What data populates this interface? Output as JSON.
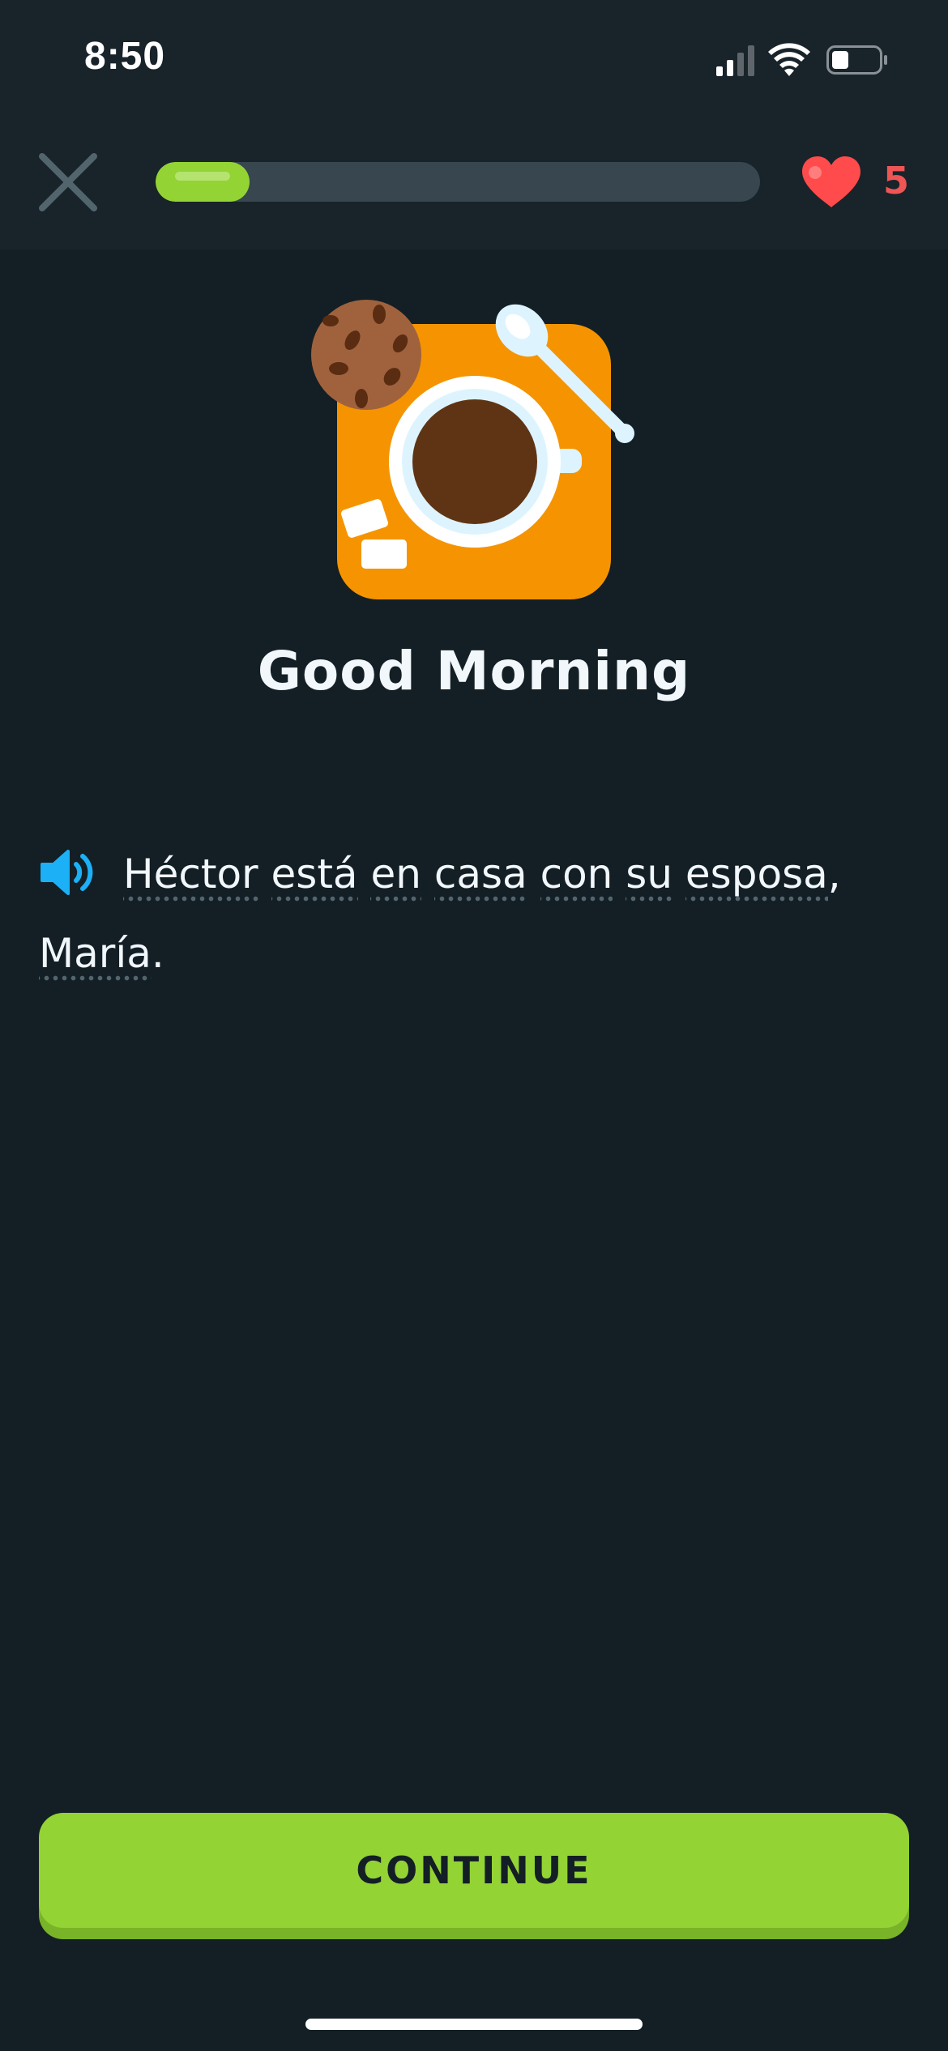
{
  "status_bar": {
    "time": "8:50",
    "icons": [
      "cellular-signal-icon",
      "wifi-icon",
      "battery-icon"
    ]
  },
  "header": {
    "close_icon": "close-icon",
    "progress_fraction": 0.155,
    "hearts_count": "5",
    "heart_icon": "heart-icon"
  },
  "lesson": {
    "illustration": "coffee-and-cookie-illustration",
    "title": "Good Morning"
  },
  "sentence": {
    "speaker_icon": "speaker-icon",
    "words": [
      "Héctor",
      "está",
      "en",
      "casa",
      "con",
      "su",
      "esposa",
      "María"
    ],
    "punctuation": [
      ",",
      "."
    ]
  },
  "footer": {
    "continue_label": "CONTINUE"
  },
  "colors": {
    "background": "#131f25",
    "accent_green": "#93d334",
    "heart_red": "#ff4b4b",
    "speaker_blue": "#1cb0f6",
    "tile_orange": "#f59400"
  }
}
